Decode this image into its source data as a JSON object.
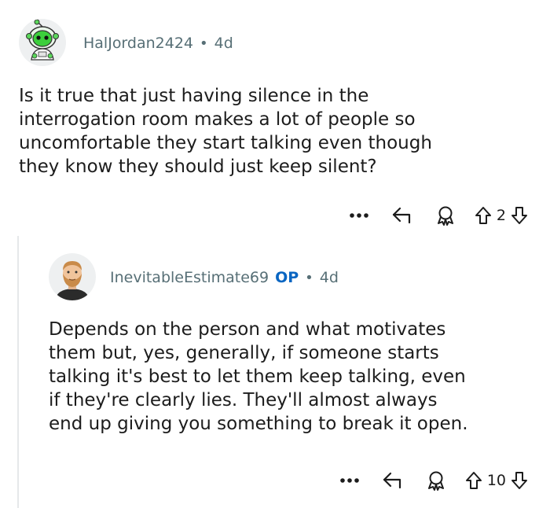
{
  "comments": [
    {
      "username": "HalJordan2424",
      "op_badge": "",
      "separator": "•",
      "age": "4d",
      "avatar_icon": "snoo-astronaut-avatar-icon",
      "body_lines": [
        "Is it true that just having silence in the",
        "interrogation room makes a lot of people so",
        "uncomfortable they start talking even though",
        "they know they should just keep silent?"
      ],
      "score": "2"
    },
    {
      "username": "InevitableEstimate69",
      "op_badge": "OP",
      "separator": "•",
      "age": "4d",
      "avatar_icon": "bearded-man-avatar-icon",
      "body_lines": [
        "Depends on the person and what motivates",
        "them but, yes, generally, if someone starts",
        "talking it's best to let them keep talking, even",
        "if they're clearly lies. They'll almost always",
        "end up giving you something to break it open."
      ],
      "score": "10"
    }
  ],
  "colors": {
    "meta": "#576f76",
    "op": "#0a66c2",
    "text": "#1c1c1c"
  }
}
